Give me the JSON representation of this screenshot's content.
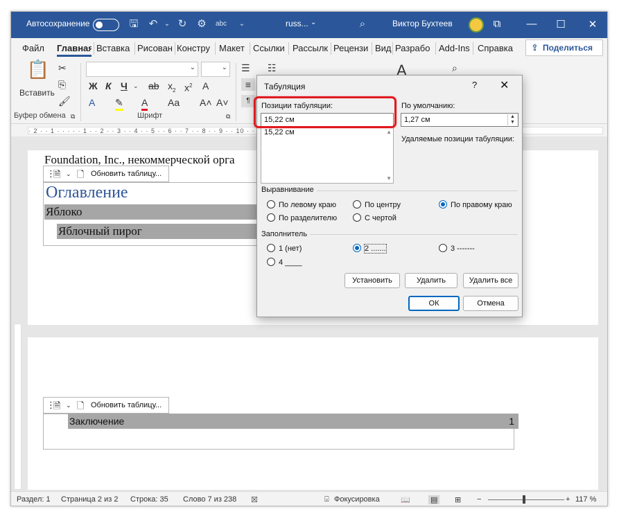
{
  "titlebar": {
    "autosave_label": "Автосохранение",
    "doc_name": "russ...",
    "doc_dropdown": "⌄",
    "user_name": "Виктор Бухтеев"
  },
  "menu": {
    "tabs": [
      "Файл",
      "Главная",
      "Вставка",
      "Рисован",
      "Констру",
      "Макет",
      "Ссылки",
      "Рассылк",
      "Рецензи",
      "Вид",
      "Разрабо",
      "Add-Ins",
      "Справка"
    ],
    "share_label": "Поделиться"
  },
  "ribbon": {
    "paste_label": "Вставить",
    "clipboard_group": "Буфер обмена",
    "font_group": "Шрифт",
    "font_name": "",
    "font_size": ""
  },
  "ruler": {
    "text": "· 2 · · 1 · · · · · 1 · · 2 · · 3 · · 4 · · 5 · · 6 · · 7 · · 8 · · 9 · · 10 · · 11 · · 12 · · 13 · · 14 · · 15 · · 16 · · 17 · · 18"
  },
  "page1": {
    "text_line": "Foundation, Inc., некоммерческой орга",
    "toc_update": "Обновить таблицу...",
    "toc_title": "Оглавление",
    "entry1": "Яблоко",
    "entry2": "Яблочный пирог"
  },
  "page2": {
    "toc_update": "Обновить таблицу...",
    "entry": "Заключение",
    "page_num": "1"
  },
  "statusbar": {
    "section": "Раздел: 1",
    "page": "Страница 2 из 2",
    "line": "Строка: 35",
    "words": "Слово 7 из 238",
    "focus": "Фокусировка",
    "zoom": "117 %"
  },
  "dialog": {
    "title": "Табуляция",
    "help": "?",
    "close": "✕",
    "tab_positions_label": "Позиции табуляции:",
    "tab_position_value": "15,22 см",
    "list_items": [
      "15,22 см"
    ],
    "default_label": "По умолчанию:",
    "default_value": "1,27 см",
    "clear_label": "Удаляемые позиции табуляции:",
    "alignment": {
      "title": "Выравнивание",
      "left": "По левому краю",
      "center": "По центру",
      "right": "По правому краю",
      "decimal": "По разделителю",
      "bar": "С чертой",
      "selected": "right"
    },
    "leader": {
      "title": "Заполнитель",
      "opt1": "1 (нет)",
      "opt2": "2 .......",
      "opt3": "3 -------",
      "opt4": "4 ____",
      "selected": "2"
    },
    "buttons": {
      "set": "Установить",
      "clear": "Удалить",
      "clear_all": "Удалить все",
      "ok": "ОК",
      "cancel": "Отмена"
    }
  },
  "colors": {
    "title_bar": "#2b579a",
    "highlight": "#e0191f",
    "toc_title": "#2f5597"
  }
}
